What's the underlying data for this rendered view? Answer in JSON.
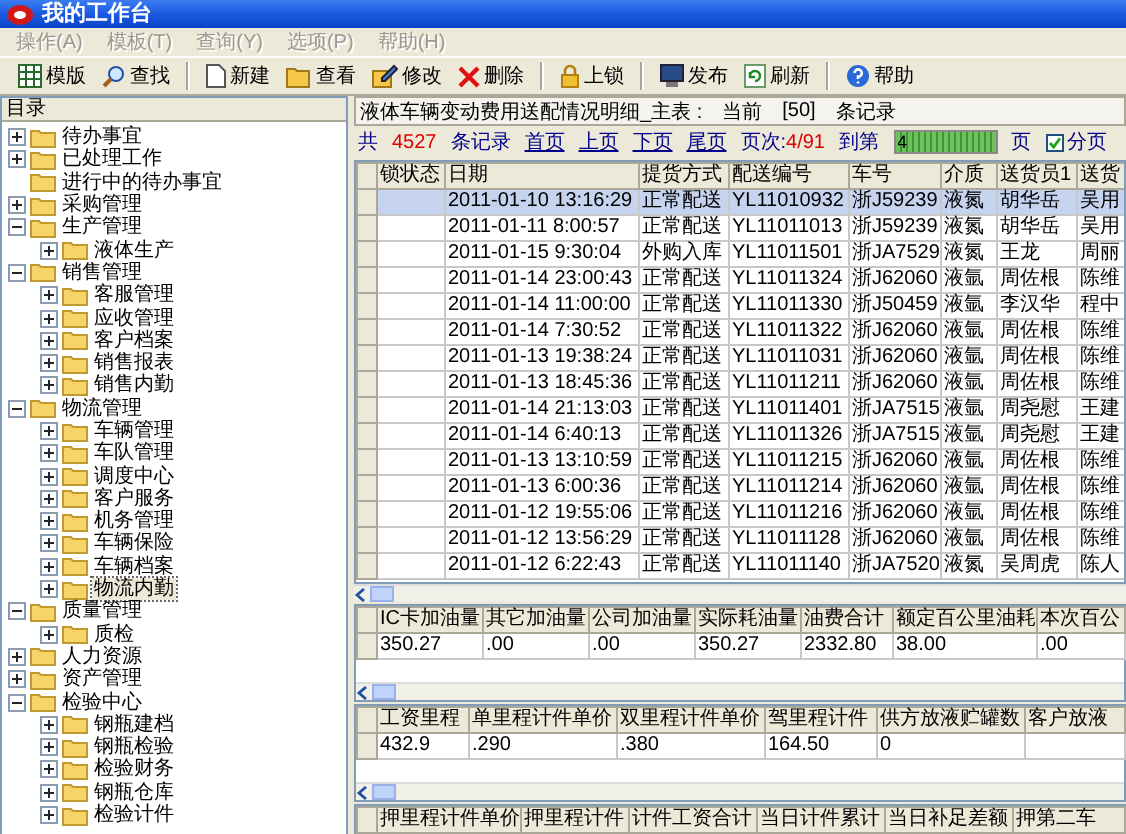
{
  "window": {
    "title": "我的工作台"
  },
  "menu": [
    {
      "label": "操作(A)",
      "disabled": true
    },
    {
      "label": "模板(T)",
      "disabled": true
    },
    {
      "label": "查询(Y)",
      "disabled": true
    },
    {
      "label": "选项(P)",
      "disabled": true
    },
    {
      "label": "帮助(H)",
      "disabled": true
    }
  ],
  "toolbar": [
    {
      "kind": "button",
      "label": "模版"
    },
    {
      "kind": "button",
      "label": "查找"
    },
    {
      "kind": "separator"
    },
    {
      "kind": "button",
      "label": "新建"
    },
    {
      "kind": "button",
      "label": "查看"
    },
    {
      "kind": "button",
      "label": "修改"
    },
    {
      "kind": "button",
      "label": "删除"
    },
    {
      "kind": "separator"
    },
    {
      "kind": "button",
      "label": "上锁"
    },
    {
      "kind": "separator"
    },
    {
      "kind": "button",
      "label": "发布"
    },
    {
      "kind": "button",
      "label": "刷新"
    },
    {
      "kind": "separator"
    },
    {
      "kind": "button",
      "label": "帮助"
    }
  ],
  "sidebar": {
    "title": "目录",
    "tree": [
      {
        "label": "待办事宜",
        "kind": "branch",
        "expanded": false,
        "selected": false
      },
      {
        "label": "已处理工作",
        "kind": "branch",
        "expanded": false,
        "selected": false
      },
      {
        "label": "进行中的待办事宜",
        "kind": "leaf",
        "selected": false
      },
      {
        "label": "采购管理",
        "kind": "branch",
        "expanded": false,
        "selected": false
      },
      {
        "label": "生产管理",
        "kind": "branch",
        "expanded": true,
        "selected": false,
        "children": [
          {
            "label": "液体生产",
            "kind": "branch",
            "expanded": false,
            "selected": false
          }
        ]
      },
      {
        "label": "销售管理",
        "kind": "branch",
        "expanded": true,
        "selected": false,
        "children": [
          {
            "label": "客服管理",
            "kind": "branch",
            "expanded": false,
            "selected": false
          },
          {
            "label": "应收管理",
            "kind": "branch",
            "expanded": false,
            "selected": false
          },
          {
            "label": "客户档案",
            "kind": "branch",
            "expanded": false,
            "selected": false
          },
          {
            "label": "销售报表",
            "kind": "branch",
            "expanded": false,
            "selected": false
          },
          {
            "label": "销售内勤",
            "kind": "branch",
            "expanded": false,
            "selected": false
          }
        ]
      },
      {
        "label": "物流管理",
        "kind": "branch",
        "expanded": true,
        "selected": false,
        "children": [
          {
            "label": "车辆管理",
            "kind": "branch",
            "expanded": false,
            "selected": false
          },
          {
            "label": "车队管理",
            "kind": "branch",
            "expanded": false,
            "selected": false
          },
          {
            "label": "调度中心",
            "kind": "branch",
            "expanded": false,
            "selected": false
          },
          {
            "label": "客户服务",
            "kind": "branch",
            "expanded": false,
            "selected": false
          },
          {
            "label": "机务管理",
            "kind": "branch",
            "expanded": false,
            "selected": false
          },
          {
            "label": "车辆保险",
            "kind": "branch",
            "expanded": false,
            "selected": false
          },
          {
            "label": "车辆档案",
            "kind": "branch",
            "expanded": false,
            "selected": false
          },
          {
            "label": "物流内勤",
            "kind": "branch",
            "expanded": false,
            "selected": true
          }
        ]
      },
      {
        "label": "质量管理",
        "kind": "branch",
        "expanded": true,
        "selected": false,
        "children": [
          {
            "label": "质检",
            "kind": "branch",
            "expanded": false,
            "selected": false
          }
        ]
      },
      {
        "label": "人力资源",
        "kind": "branch",
        "expanded": false,
        "selected": false
      },
      {
        "label": "资产管理",
        "kind": "branch",
        "expanded": false,
        "selected": false
      },
      {
        "label": "检验中心",
        "kind": "branch",
        "expanded": true,
        "selected": false,
        "children": [
          {
            "label": "钢瓶建档",
            "kind": "branch",
            "expanded": false,
            "selected": false
          },
          {
            "label": "钢瓶检验",
            "kind": "branch",
            "expanded": false,
            "selected": false
          },
          {
            "label": "检验财务",
            "kind": "branch",
            "expanded": false,
            "selected": false
          },
          {
            "label": "钢瓶仓库",
            "kind": "branch",
            "expanded": false,
            "selected": false
          },
          {
            "label": "检验计件",
            "kind": "branch",
            "expanded": false,
            "selected": false
          }
        ]
      }
    ]
  },
  "main": {
    "caption": "液体车辆变动费用送配情况明细_主表 :",
    "current_label": "当前",
    "current_count": "[50]",
    "records_label": "条记录"
  },
  "pager": {
    "total_label": "共",
    "total": "4527",
    "records_label": "条记录",
    "links": [
      "首页",
      "上页",
      "下页",
      "尾页"
    ],
    "page_label": "页次:",
    "page": "4/91",
    "goto_label": "到第",
    "goto_value": "4",
    "page_unit": "页",
    "paging": {
      "label": "分页",
      "checked": true
    }
  },
  "table": {
    "columns": [
      "锁状态",
      "日期",
      "提货方式",
      "配送编号",
      "车号",
      "介质",
      "送货员1",
      "送货"
    ],
    "rows": [
      {
        "selected": true,
        "cells": [
          "",
          "2011-01-10 13:16:29",
          "正常配送",
          "YL11010932",
          "浙J59239",
          "液氮",
          "胡华岳",
          "吴用"
        ]
      },
      {
        "selected": false,
        "cells": [
          "",
          "2011-01-11 8:00:57",
          "正常配送",
          "YL11011013",
          "浙J59239",
          "液氮",
          "胡华岳",
          "吴用"
        ]
      },
      {
        "selected": false,
        "cells": [
          "",
          "2011-01-15 9:30:04",
          "外购入库",
          "YL11011501",
          "浙JA7529",
          "液氮",
          "王龙",
          "周丽"
        ]
      },
      {
        "selected": false,
        "cells": [
          "",
          "2011-01-14 23:00:43",
          "正常配送",
          "YL11011324",
          "浙J62060",
          "液氩",
          "周佐根",
          "陈维"
        ]
      },
      {
        "selected": false,
        "cells": [
          "",
          "2011-01-14 11:00:00",
          "正常配送",
          "YL11011330",
          "浙J50459",
          "液氩",
          "李汉华",
          "程中"
        ]
      },
      {
        "selected": false,
        "cells": [
          "",
          "2011-01-14 7:30:52",
          "正常配送",
          "YL11011322",
          "浙J62060",
          "液氩",
          "周佐根",
          "陈维"
        ]
      },
      {
        "selected": false,
        "cells": [
          "",
          "2011-01-13 19:38:24",
          "正常配送",
          "YL11011031",
          "浙J62060",
          "液氩",
          "周佐根",
          "陈维"
        ]
      },
      {
        "selected": false,
        "cells": [
          "",
          "2011-01-13 18:45:36",
          "正常配送",
          "YL11011211",
          "浙J62060",
          "液氩",
          "周佐根",
          "陈维"
        ]
      },
      {
        "selected": false,
        "cells": [
          "",
          "2011-01-14 21:13:03",
          "正常配送",
          "YL11011401",
          "浙JA7515",
          "液氩",
          "周尧慰",
          "王建"
        ]
      },
      {
        "selected": false,
        "cells": [
          "",
          "2011-01-14 6:40:13",
          "正常配送",
          "YL11011326",
          "浙JA7515",
          "液氩",
          "周尧慰",
          "王建"
        ]
      },
      {
        "selected": false,
        "cells": [
          "",
          "2011-01-13 13:10:59",
          "正常配送",
          "YL11011215",
          "浙J62060",
          "液氩",
          "周佐根",
          "陈维"
        ]
      },
      {
        "selected": false,
        "cells": [
          "",
          "2011-01-13 6:00:36",
          "正常配送",
          "YL11011214",
          "浙J62060",
          "液氩",
          "周佐根",
          "陈维"
        ]
      },
      {
        "selected": false,
        "cells": [
          "",
          "2011-01-12 19:55:06",
          "正常配送",
          "YL11011216",
          "浙J62060",
          "液氩",
          "周佐根",
          "陈维"
        ]
      },
      {
        "selected": false,
        "cells": [
          "",
          "2011-01-12 13:56:29",
          "正常配送",
          "YL11011128",
          "浙J62060",
          "液氩",
          "周佐根",
          "陈维"
        ]
      },
      {
        "selected": false,
        "cells": [
          "",
          "2011-01-12 6:22:43",
          "正常配送",
          "YL11011140",
          "浙JA7520",
          "液氮",
          "吴周虎",
          "陈人"
        ]
      }
    ]
  },
  "details": [
    {
      "columns": [
        "IC卡加油量",
        "其它加油量",
        "公司加油量",
        "实际耗油量",
        "油费合计",
        "额定百公里油耗",
        "本次百公"
      ],
      "rows": [
        {
          "cells": [
            "350.27",
            ".00",
            ".00",
            "350.27",
            "2332.80",
            "38.00",
            ".00"
          ]
        }
      ]
    },
    {
      "columns": [
        "工资里程",
        "单里程计件单价",
        "双里程计件单价",
        "驾里程计件",
        "供方放液贮罐数",
        "客户放液"
      ],
      "rows": [
        {
          "cells": [
            "432.9",
            ".290",
            ".380",
            "164.50",
            "0"
          ]
        }
      ]
    },
    {
      "columns": [
        "押里程计件单价",
        "押里程计件",
        "计件工资合计",
        "当日计件累计",
        "当日补足差额",
        "押第二车"
      ]
    }
  ]
}
